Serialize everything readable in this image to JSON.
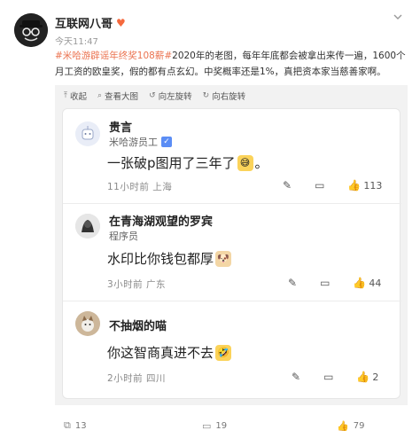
{
  "post": {
    "username": "互联网八哥",
    "badge_icon": "heart-badge-icon",
    "time": "今天11:47",
    "hashtag": "#米哈游辟谣年终奖108薪#",
    "text": "2020年的老图，每年年底都会被拿出来传一遍，1600个月工资的欧皇奖，假的都有点玄幻。中奖概率还是1%，真把资本家当慈善家啊。"
  },
  "toolbar": {
    "collapse": "收起",
    "view_large": "查看大图",
    "rotate_left": "向左旋转",
    "rotate_right": "向右旋转"
  },
  "comments": [
    {
      "name": "贵言",
      "role": "米哈游员工",
      "verified": true,
      "text": "一张破p图用了三年了",
      "emoji": "sweat-smile-emoji",
      "time": "11小时前",
      "location": "上海",
      "likes": "113"
    },
    {
      "name": "在青海湖观望的罗宾",
      "role": "程序员",
      "verified": false,
      "text": "水印比你钱包都厚",
      "emoji": "dog-emoji",
      "time": "3小时前",
      "location": "广东",
      "likes": "44"
    },
    {
      "name": "不抽烟的喵",
      "role": "",
      "verified": false,
      "text": "你这智商真进不去",
      "emoji": "laugh-emoji",
      "time": "2小时前",
      "location": "四川",
      "likes": "2"
    }
  ],
  "footer": {
    "reposts": "13",
    "comments": "19",
    "likes": "79"
  }
}
